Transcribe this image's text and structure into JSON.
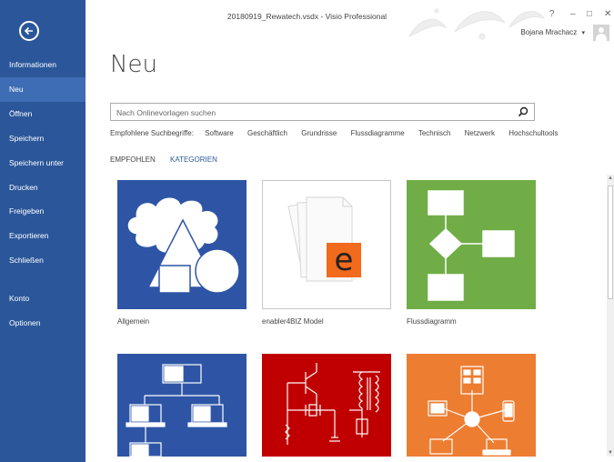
{
  "window": {
    "title": "20180919_Rewatech.vsdx - Visio Professional",
    "help": "?",
    "minimize": "–",
    "restore": "□",
    "close": "✕"
  },
  "user": {
    "name": "Bojana Mrachacz",
    "dropdown": "▾"
  },
  "sidebar": {
    "back_icon": "back-arrow-icon",
    "items": [
      {
        "label": "Informationen"
      },
      {
        "label": "Neu",
        "active": true
      },
      {
        "label": "Öffnen"
      },
      {
        "label": "Speichern"
      },
      {
        "label": "Speichern unter"
      },
      {
        "label": "Drucken"
      },
      {
        "label": "Freigeben"
      },
      {
        "label": "Exportieren"
      },
      {
        "label": "Schließen"
      },
      {
        "label": "Konto"
      },
      {
        "label": "Optionen"
      }
    ]
  },
  "main": {
    "title": "Neu",
    "search": {
      "placeholder": "Nach Onlinevorlagen suchen",
      "value": ""
    },
    "suggested": {
      "label": "Empfohlene Suchbegriffe:",
      "terms": [
        "Software",
        "Geschäftlich",
        "Grundrisse",
        "Flussdiagramme",
        "Technisch",
        "Netzwerk",
        "Hochschultools"
      ]
    },
    "tabs": [
      {
        "label": "EMPFOHLEN",
        "active": true
      },
      {
        "label": "KATEGORIEN",
        "active": false
      }
    ],
    "templates": [
      {
        "label": "Allgemein",
        "color": "#2e55a5"
      },
      {
        "label": "enabler4BIZ Model",
        "color": "#ffffff",
        "logo_letter": "e",
        "logo_color": "#f26a1b"
      },
      {
        "label": "Flussdiagramm",
        "color": "#70ad47"
      },
      {
        "label": "",
        "color": "#2e55a5"
      },
      {
        "label": "",
        "color": "#c00000"
      },
      {
        "label": "",
        "color": "#ed7d31"
      }
    ]
  },
  "colors": {
    "accent": "#2b579a",
    "accent_active": "#3e6db5",
    "tab_inactive": "#2b579a"
  }
}
